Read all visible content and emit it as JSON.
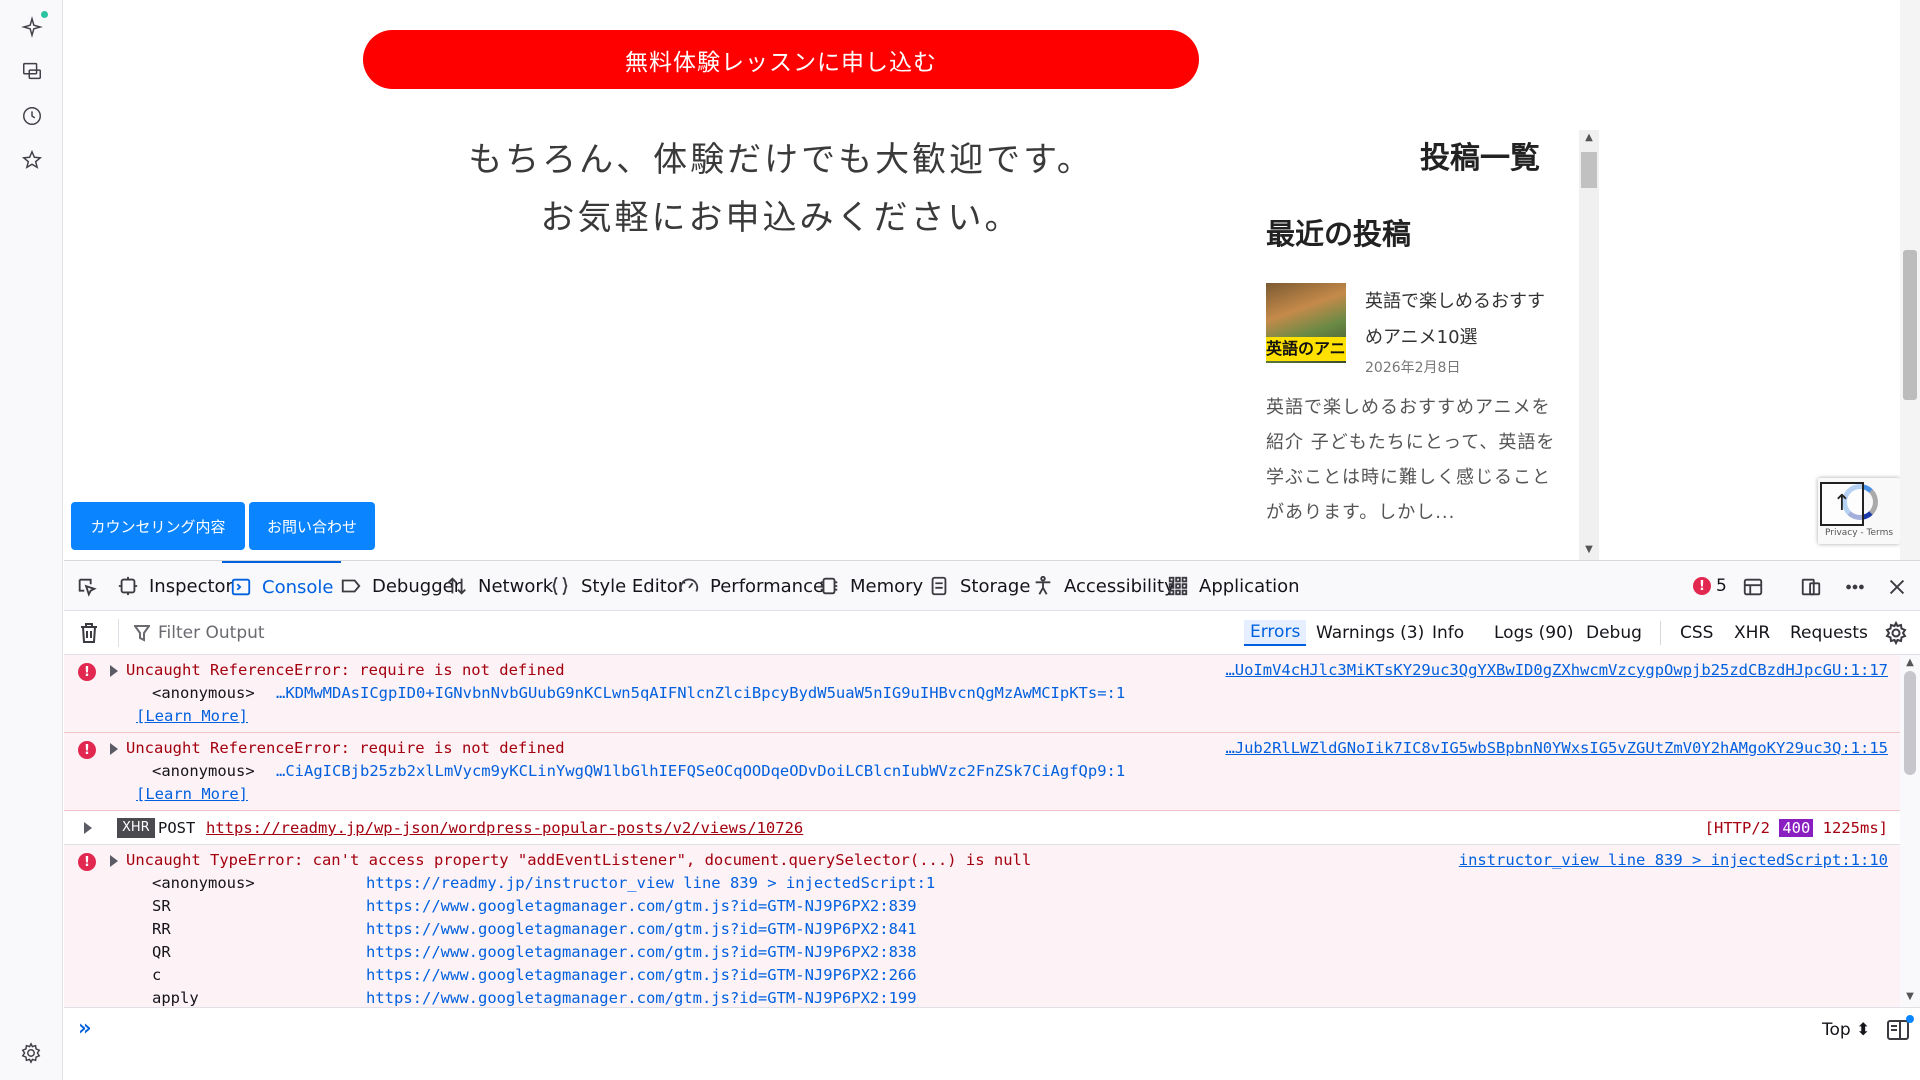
{
  "browser_sidebar": {
    "icons": [
      "ai-sparkle-icon",
      "synced-tabs-icon",
      "history-icon",
      "bookmarks-icon",
      "settings-icon"
    ]
  },
  "webpage": {
    "cta_button": "無料体験レッスンに申し込む",
    "hero_line1": "もちろん、体験だけでも大歓迎です。",
    "hero_line2": "お気軽にお申込みください。",
    "side_heading": "投稿一覧",
    "recent_heading": "最近の投稿",
    "thumb_label": "英語のアニメ",
    "post_title": "英語で楽しめるおすすめアニメ10選",
    "post_date": "2026年2月8日",
    "excerpt": "英語で楽しめるおすすめアニメを紹介 子どもたちにとって、英語を学ぶことは時に難しく感じることがあります。しかし...",
    "btn_counseling": "カウンセリング内容",
    "btn_contact": "お問い合わせ",
    "recaptcha_terms": "Privacy - Terms",
    "to_top": "↑"
  },
  "devtools": {
    "tabs": {
      "inspector": "Inspector",
      "console": "Console",
      "debugger": "Debugger",
      "network": "Network",
      "style_editor": "Style Editor",
      "performance": "Performance",
      "memory": "Memory",
      "storage": "Storage",
      "accessibility": "Accessibility",
      "application": "Application"
    },
    "error_count": "5",
    "filter_placeholder": "Filter Output",
    "filters": {
      "errors": "Errors",
      "warnings": "Warnings (3)",
      "info": "Info",
      "logs": "Logs (90)",
      "debug": "Debug",
      "css": "CSS",
      "xhr": "XHR",
      "requests": "Requests"
    },
    "messages": {
      "m1": {
        "text": "Uncaught ReferenceError: require is not defined",
        "fn": "<anonymous>",
        "loc": "…KDMwMDAsICgpID0+IGNvbnNvbGUubG9nKCLwn5qAIFNlcnZlciBpcyBydW5uaW5nIG9uIHBvcnQgMzAwMCIpKTs=:1",
        "learn": "[Learn More]",
        "src": "…UoImV4cHJlc3MiKTsKY29uc3QgYXBwID0gZXhwcmVzcygpOwpjb25zdCBzdHJpcGU:1:17"
      },
      "m2": {
        "text": "Uncaught ReferenceError: require is not defined",
        "fn": "<anonymous>",
        "loc": "…CiAgICBjb25zb2xlLmVycm9yKCLinYwgQW1lbGlhIEFQSeOCqOODqeODvDoiLCBlcnIubWVzc2FnZSk7CiAgfQp9:1",
        "learn": "[Learn More]",
        "src": "…Jub2RlLWZldGNoIik7IC8vIG5wbSBpbnN0YWxsIG5vZGUtZmV0Y2hAMgoKY29uc3Q:1:15"
      },
      "m3": {
        "badge": "XHR",
        "method": "POST",
        "url": "https://readmy.jp/wp-json/wordpress-popular-posts/v2/views/10726",
        "status_prefix": "[HTTP/2",
        "status_code": "400",
        "status_suffix": "1225ms]"
      },
      "m4": {
        "text": "Uncaught TypeError: can't access property \"addEventListener\", document.querySelector(...) is null",
        "src": "instructor_view line 839 > injectedScript:1:10",
        "stack": [
          {
            "fn": "<anonymous>",
            "loc": "https://readmy.jp/instructor_view line 839 > injectedScript:1"
          },
          {
            "fn": "SR",
            "loc": "https://www.googletagmanager.com/gtm.js?id=GTM-NJ9P6PX2:839"
          },
          {
            "fn": "RR",
            "loc": "https://www.googletagmanager.com/gtm.js?id=GTM-NJ9P6PX2:841"
          },
          {
            "fn": "QR",
            "loc": "https://www.googletagmanager.com/gtm.js?id=GTM-NJ9P6PX2:838"
          },
          {
            "fn": "c",
            "loc": "https://www.googletagmanager.com/gtm.js?id=GTM-NJ9P6PX2:266"
          },
          {
            "fn": "apply",
            "loc": "https://www.googletagmanager.com/gtm.js?id=GTM-NJ9P6PX2:199"
          }
        ]
      }
    },
    "input_prompt": "»",
    "context_selector": "Top ⬍"
  },
  "colors": {
    "cta_red": "#ff0000",
    "accent_blue": "#0061e0",
    "button_blue": "#0a84ff",
    "error_red": "#e22850",
    "error_bg": "#fdf2f5"
  }
}
